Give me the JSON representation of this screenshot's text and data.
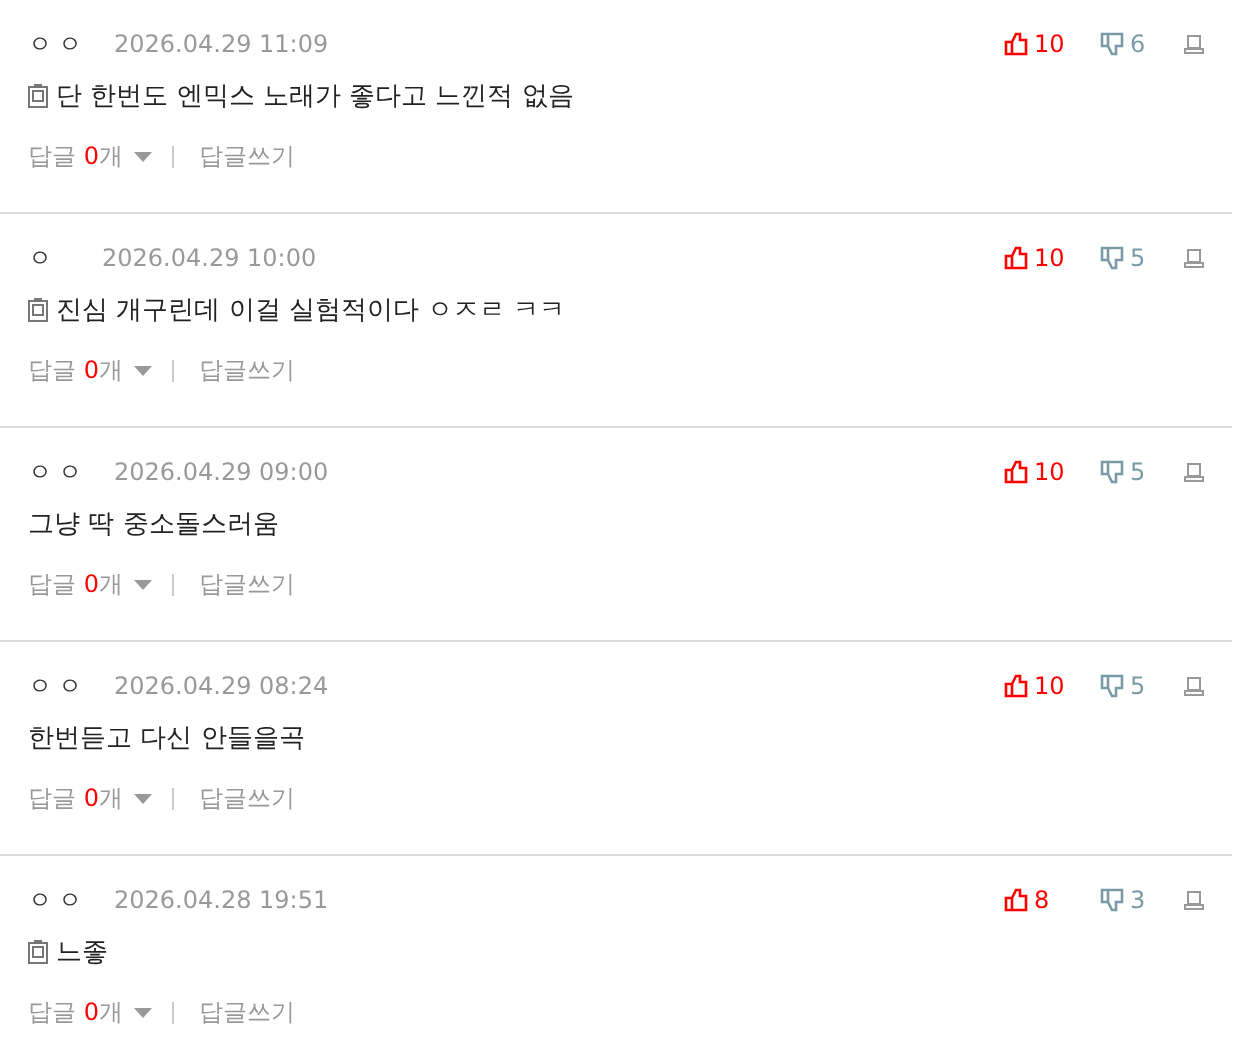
{
  "comments": [
    {
      "author": "ㅇㅇ",
      "date": "2026.04.29 11:09",
      "memo_icon": true,
      "text": "단 한번도 엔믹스 노래가 좋다고 느낀적 없음",
      "likes": "10",
      "dislikes": "6",
      "reply_label": "답글",
      "reply_count": "0",
      "reply_unit": "개",
      "write_reply": "답글쓰기"
    },
    {
      "author": "ㅇ",
      "date": "2026.04.29 10:00",
      "memo_icon": true,
      "text": "진심 개구린데 이걸 실험적이다 ㅇㅈㄹ ㅋㅋ",
      "likes": "10",
      "dislikes": "5",
      "reply_label": "답글",
      "reply_count": "0",
      "reply_unit": "개",
      "write_reply": "답글쓰기"
    },
    {
      "author": "ㅇㅇ",
      "date": "2026.04.29 09:00",
      "memo_icon": false,
      "text": "그냥 딱 중소돌스러움",
      "likes": "10",
      "dislikes": "5",
      "reply_label": "답글",
      "reply_count": "0",
      "reply_unit": "개",
      "write_reply": "답글쓰기"
    },
    {
      "author": "ㅇㅇ",
      "date": "2026.04.29 08:24",
      "memo_icon": false,
      "text": "한번듣고 다신 안들을곡",
      "likes": "10",
      "dislikes": "5",
      "reply_label": "답글",
      "reply_count": "0",
      "reply_unit": "개",
      "write_reply": "답글쓰기"
    },
    {
      "author": "ㅇㅇ",
      "date": "2026.04.28 19:51",
      "memo_icon": true,
      "text": "느좋",
      "likes": "8",
      "dislikes": "3",
      "reply_label": "답글",
      "reply_count": "0",
      "reply_unit": "개",
      "write_reply": "답글쓰기"
    }
  ]
}
